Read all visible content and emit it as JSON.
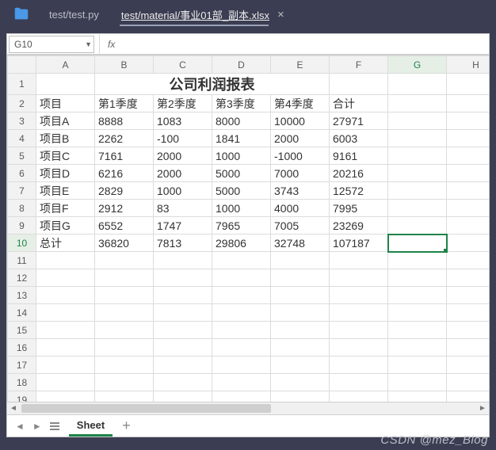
{
  "tabs": [
    {
      "label": "test/test.py",
      "active": false
    },
    {
      "label": "test/material/事业01部_副本.xlsx",
      "active": true
    }
  ],
  "namebox": "G10",
  "fx_label": "fx",
  "columns": [
    "A",
    "B",
    "C",
    "D",
    "E",
    "F",
    "G",
    "H"
  ],
  "row_count": 20,
  "selected": {
    "col": "G",
    "row": 10
  },
  "title": "公司利润报表",
  "headers": [
    "项目",
    "第1季度",
    "第2季度",
    "第3季度",
    "第4季度",
    "合计"
  ],
  "rows": [
    [
      "项目A",
      "8888",
      "1083",
      "8000",
      "10000",
      "27971"
    ],
    [
      "项目B",
      "2262",
      "-100",
      "1841",
      "2000",
      "6003"
    ],
    [
      "项目C",
      "7161",
      "2000",
      "1000",
      "-1000",
      "9161"
    ],
    [
      "项目D",
      "6216",
      "2000",
      "5000",
      "7000",
      "20216"
    ],
    [
      "项目E",
      "2829",
      "1000",
      "5000",
      "3743",
      "12572"
    ],
    [
      "项目F",
      "2912",
      "83",
      "1000",
      "4000",
      "7995"
    ],
    [
      "项目G",
      "6552",
      "1747",
      "7965",
      "7005",
      "23269"
    ],
    [
      "总计",
      "36820",
      "7813",
      "29806",
      "32748",
      "107187"
    ]
  ],
  "sheet_name": "Sheet",
  "watermark": "CSDN @mez_Blog"
}
